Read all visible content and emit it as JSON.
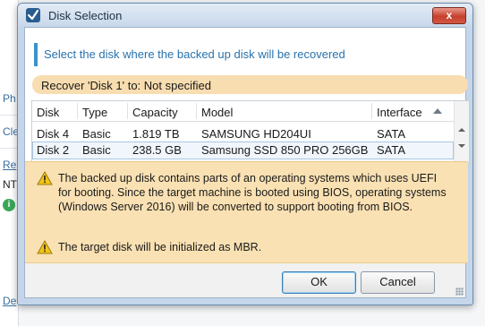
{
  "background": {
    "fragments": [
      "Ph",
      "Cle",
      "Re",
      "NT",
      "De"
    ],
    "info_icon": "info-icon"
  },
  "dialog": {
    "title": "Disk Selection",
    "close_label": "x",
    "instruction": "Select the disk where the backed up disk will be recovered",
    "recover_text": "Recover 'Disk 1' to:  Not specified",
    "table": {
      "columns": [
        "Disk",
        "Type",
        "Capacity",
        "Model",
        "Interface"
      ],
      "sorted_column": "Interface",
      "rows": [
        {
          "disk": "Disk 4",
          "type": "Basic",
          "capacity": "1.819 TB",
          "model": "SAMSUNG HD204UI",
          "interface": "SATA"
        },
        {
          "disk": "Disk 2",
          "type": "Basic",
          "capacity": "238.5 GB",
          "model": "Samsung SSD 850 PRO 256GB",
          "interface": "SATA"
        }
      ],
      "selected_row": 1
    },
    "warnings": [
      "The backed up disk contains parts of an operating systems which uses UEFI for booting. Since the target machine is booted using BIOS, operating systems (Windows Server 2016) will be converted to support booting from BIOS.",
      "The target disk will be initialized as MBR."
    ],
    "buttons": {
      "ok": "OK",
      "cancel": "Cancel"
    }
  },
  "colors": {
    "instruction_text": "#2872ad",
    "recover_band": "#f8ddb0",
    "warning_bg": "#fae1b3",
    "close_button": "#c6402c"
  }
}
